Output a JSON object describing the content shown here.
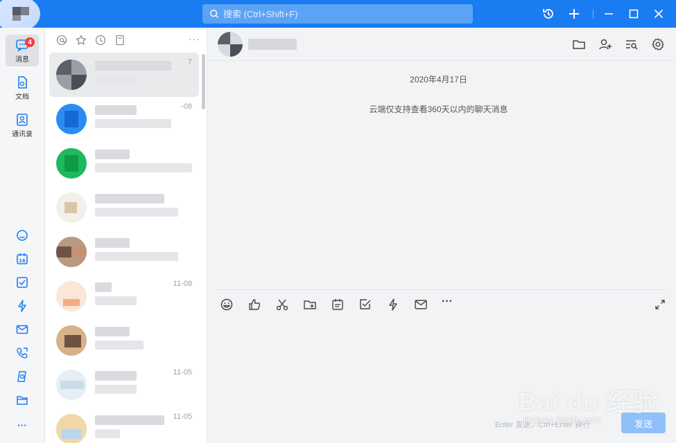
{
  "topbar": {
    "search_placeholder": "搜索 (Ctrl+Shift+F)",
    "history_icon": "history-clock-icon",
    "add_icon": "plus-icon",
    "minimize_icon": "minimize-icon",
    "maximize_icon": "maximize-icon",
    "close_icon": "close-icon"
  },
  "rail": {
    "items": [
      {
        "label": "消息",
        "icon": "message-icon",
        "badge": "4",
        "active": true
      },
      {
        "label": "文档",
        "icon": "document-icon"
      },
      {
        "label": "通讯录",
        "icon": "contacts-icon"
      }
    ],
    "bottom_icons": [
      "cloud-icon",
      "calendar-icon",
      "task-check-icon",
      "lightning-icon",
      "mail-icon",
      "phone-call-icon",
      "drive-icon",
      "folder-icon",
      "more-icon"
    ],
    "calendar_day": "16",
    "more": "···"
  },
  "list": {
    "tools": [
      "at-icon",
      "star-icon",
      "clock-icon",
      "bookmark-icon"
    ],
    "more": "···",
    "items": [
      {
        "time": "7"
      },
      {
        "time": "-08"
      },
      {
        "time": ""
      },
      {
        "time": ""
      },
      {
        "time": ""
      },
      {
        "time": "11-08"
      },
      {
        "time": ""
      },
      {
        "time": "11-05"
      },
      {
        "time": "11-05"
      }
    ]
  },
  "chat": {
    "header_icons": [
      "folder-icon",
      "add-member-icon",
      "search-history-icon",
      "settings-gear-icon"
    ],
    "date": "2020年4月17日",
    "notice": "云端仅支持查看360天以内的聊天消息",
    "toolbar_icons": [
      "emoji-icon",
      "thumbs-up-icon",
      "scissors-icon",
      "folder-add-icon",
      "notepad-icon",
      "checkbox-icon",
      "lightning-icon",
      "mail-icon",
      "more-icon"
    ],
    "toolbar_more": "···",
    "send_hint": "Enter 发送，Ctrl+Enter 换行",
    "send_label": "发送"
  },
  "watermark": {
    "brand": "Bai du 经验",
    "url": "jingyan.baidu.com"
  },
  "colors": {
    "accent": "#1a7cf1",
    "badge": "#f23c3c",
    "send_button": "#8fc0fa"
  }
}
